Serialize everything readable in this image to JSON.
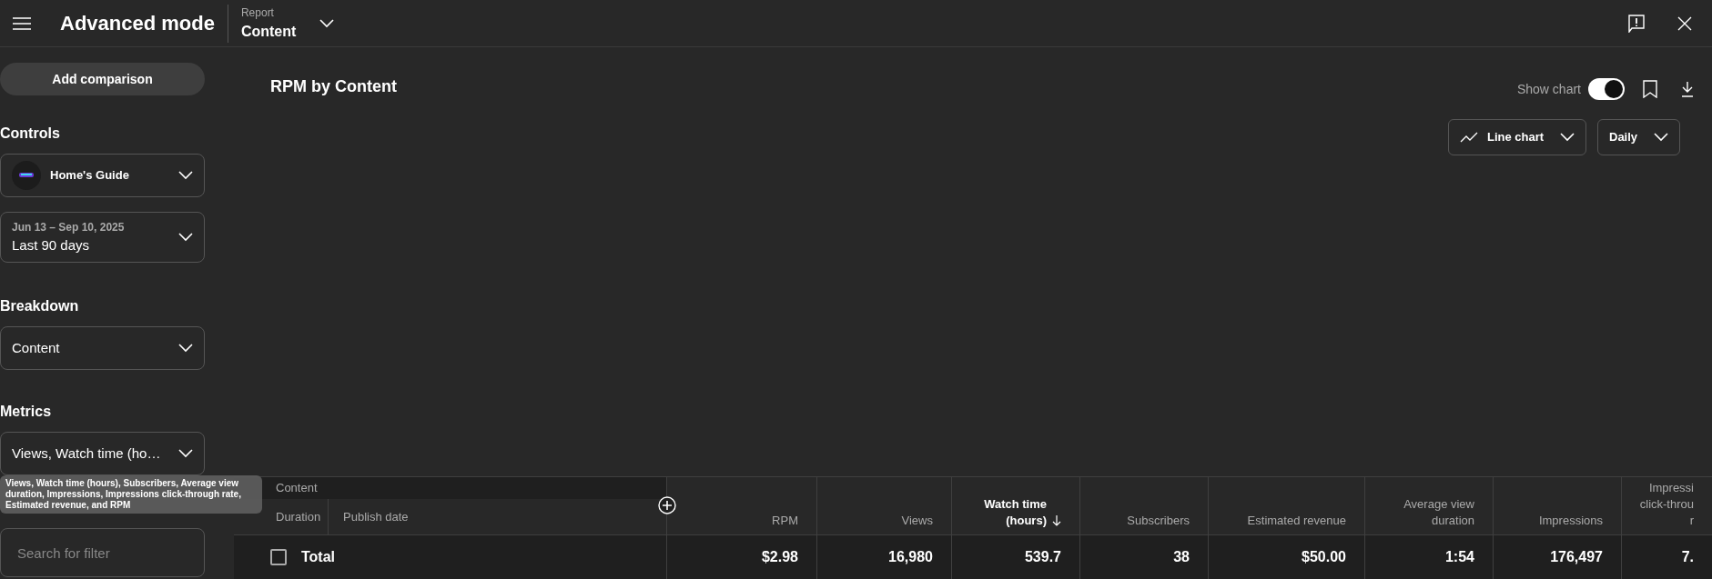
{
  "header": {
    "title": "Advanced mode",
    "report_label": "Report",
    "report_value": "Content"
  },
  "sidebar": {
    "add_comparison": "Add comparison",
    "controls": {
      "heading": "Controls",
      "channel": "Home's Guide",
      "date_range": "Jun 13 – Sep 10, 2025",
      "period": "Last 90 days"
    },
    "breakdown": {
      "heading": "Breakdown",
      "value": "Content"
    },
    "metrics": {
      "heading": "Metrics",
      "value": "Views, Watch time (ho…",
      "tooltip": "Views, Watch time (hours), Subscribers, Average view duration, Impressions, Impressions click-through rate, Estimated revenue, and RPM"
    },
    "filter": {
      "placeholder": "Search for filter"
    }
  },
  "report": {
    "title": "RPM by Content",
    "show_chart_label": "Show chart",
    "show_chart": true,
    "chart_type": "Line chart",
    "interval": "Daily"
  },
  "table": {
    "group_header": "Content",
    "sub_columns": [
      "Duration",
      "Publish date"
    ],
    "columns": [
      {
        "label": "RPM",
        "sorted": false
      },
      {
        "label": "Views",
        "sorted": false
      },
      {
        "label": "Watch time (hours)",
        "sorted": true
      },
      {
        "label": "Subscribers",
        "sorted": false
      },
      {
        "label": "Estimated revenue",
        "sorted": false
      },
      {
        "label": "Average view duration",
        "sorted": false
      },
      {
        "label": "Impressions",
        "sorted": false
      },
      {
        "label": "Impressi\nclick-throu\nr",
        "sorted": false
      }
    ],
    "total_row": {
      "checked": false,
      "label": "Total",
      "values": [
        "$2.98",
        "16,980",
        "539.7",
        "38",
        "$50.00",
        "1:54",
        "176,497",
        "7."
      ]
    }
  }
}
